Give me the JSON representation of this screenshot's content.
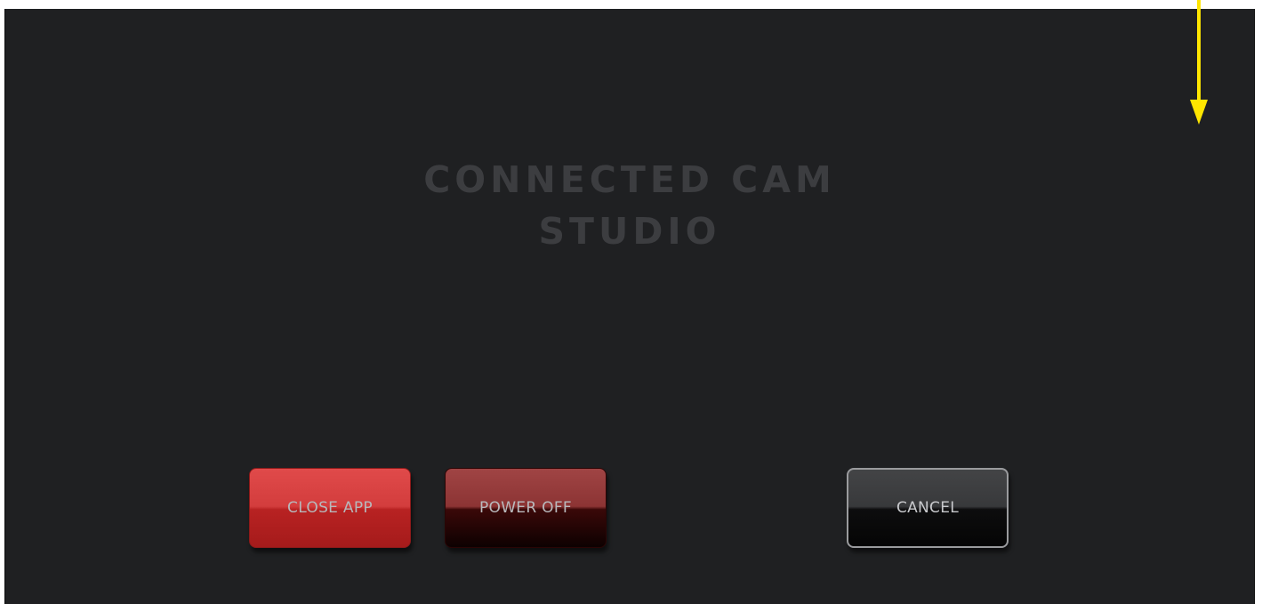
{
  "app": {
    "title_line1": "CONNECTED CAM",
    "title_line2": "STUDIO"
  },
  "actions": {
    "close_app_label": "CLOSE APP",
    "power_off_label": "POWER OFF",
    "cancel_label": "CANCEL"
  },
  "overlay": {
    "arrow_icon": "down-arrow-icon",
    "arrow_color": "#ffe600"
  }
}
